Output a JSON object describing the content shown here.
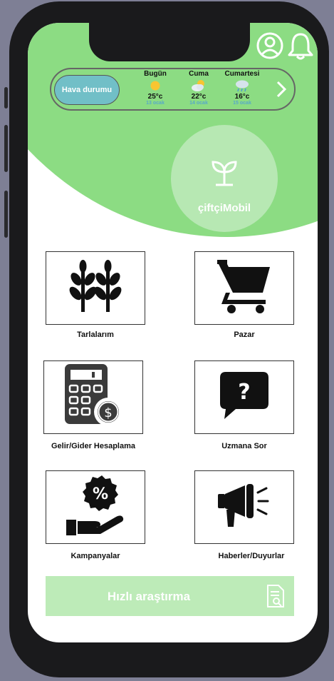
{
  "header": {
    "icons": [
      "user-circle-icon",
      "bell-icon"
    ]
  },
  "weather": {
    "button_label": "Hava durumu",
    "days": [
      {
        "name": "Bugün",
        "temp": "25°c",
        "date": "13 ocak",
        "icon": "sun-icon"
      },
      {
        "name": "Cuma",
        "temp": "22°c",
        "date": "14 ocak",
        "icon": "sun-cloud-icon"
      },
      {
        "name": "Cumartesi",
        "temp": "16°c",
        "date": "15 ocak",
        "icon": "rain-cloud-icon"
      }
    ],
    "next_icon": "chevron-right-icon"
  },
  "logo": {
    "name": "çiftçiMobil",
    "icon": "sprout-icon"
  },
  "menu": [
    {
      "label": "Tarlalarım",
      "icon": "wheat-icon"
    },
    {
      "label": "Pazar",
      "icon": "shopping-cart-icon"
    },
    {
      "label": "Gelir/Gider Hesaplama",
      "icon": "calculator-icon"
    },
    {
      "label": "Uzmana Sor",
      "icon": "question-bubble-icon"
    },
    {
      "label": "Kampanyalar",
      "icon": "discount-hand-icon"
    },
    {
      "label": "Haberler/Duyurlar",
      "icon": "megaphone-icon"
    }
  ],
  "quick_search": {
    "label": "Hızlı araştırma",
    "icon": "document-search-icon"
  },
  "colors": {
    "brand_green": "#8cdc83",
    "light_green": "#bdebb8",
    "weather_button": "#71bfc7",
    "date_blue": "#58a9c9"
  }
}
